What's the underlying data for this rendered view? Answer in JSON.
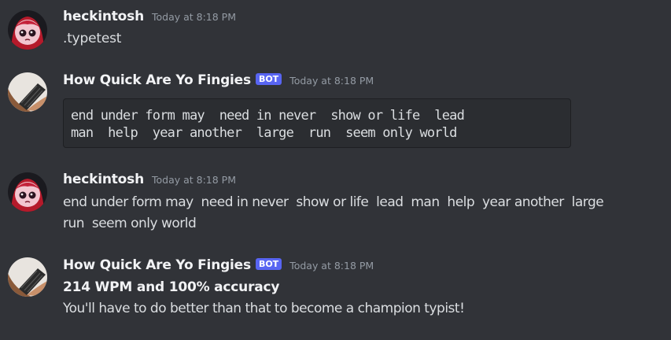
{
  "messages": [
    {
      "username": "heckintosh",
      "timestamp": "Today at 8:18 PM",
      "avatar_icon": "anime-girl-avatar",
      "text": ".typetest"
    },
    {
      "username": "How Quick Are Yo Fingies",
      "bot_tag": "BOT",
      "timestamp": "Today at 8:18 PM",
      "avatar_icon": "keyboard-avatar",
      "code_lines": [
        "end under form may  need in never  show or life  lead",
        "man  help  year another  large  run  seem only world"
      ]
    },
    {
      "username": "heckintosh",
      "timestamp": "Today at 8:18 PM",
      "avatar_icon": "anime-girl-avatar",
      "lines": [
        "end under form may  need in never  show or life  lead  man  help  year another  large",
        "run  seem only world"
      ]
    },
    {
      "username": "How Quick Are Yo Fingies",
      "bot_tag": "BOT",
      "timestamp": "Today at 8:18 PM",
      "avatar_icon": "keyboard-avatar",
      "bold_line": "214 WPM and 100% accuracy",
      "line": "You'll have to do better than that to become a champion typist!"
    }
  ],
  "colors": {
    "background": "#313338",
    "bot_tag": "#5865f2",
    "code_block_bg": "#2b2d31",
    "timestamp": "#949ba4"
  }
}
